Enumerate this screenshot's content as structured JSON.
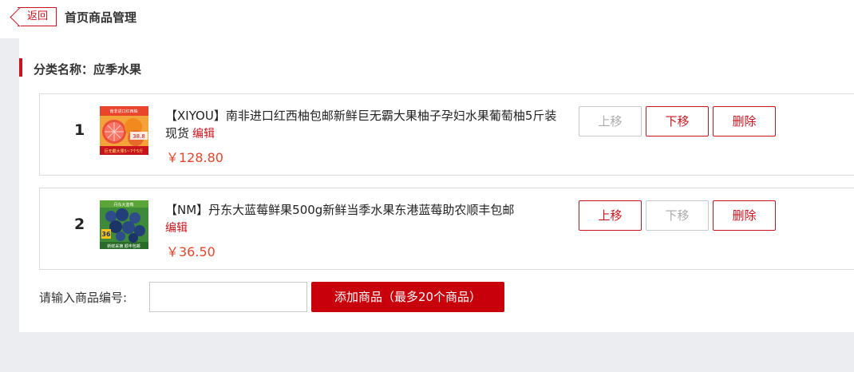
{
  "header": {
    "back_label": "返回",
    "title": "首页商品管理"
  },
  "category": {
    "label": "分类名称：应季水果"
  },
  "products": [
    {
      "index": "1",
      "name": "【XIYOU】南非进口红西柚包邮新鲜巨无霸大果柚子孕妇水果葡萄柚5斤装现货",
      "edit_label": "编辑",
      "price": "￥128.80",
      "thumb_text_top": "南非进口红西柚",
      "thumb_text_bottom": "巨无霸大果5~7个5斤",
      "thumb_badge": "38.8",
      "up_label": "上移",
      "up_disabled": true,
      "down_label": "下移",
      "down_disabled": false,
      "delete_label": "删除"
    },
    {
      "index": "2",
      "name": "【NM】丹东大蓝莓鲜果500g新鲜当季水果东港蓝莓助农顺丰包邮",
      "edit_label": "编辑",
      "price": "￥36.50",
      "thumb_text_top": "丹东大蓝莓",
      "thumb_text_bottom": "新鲜采摘 顺丰包邮",
      "thumb_badge": "36",
      "up_label": "上移",
      "up_disabled": false,
      "down_label": "下移",
      "down_disabled": true,
      "delete_label": "删除"
    }
  ],
  "add_section": {
    "label": "请输入商品编号:",
    "input_value": "",
    "input_placeholder": "",
    "add_button_label": "添加商品（最多20个商品）"
  },
  "colors": {
    "accent": "#c8151d",
    "price": "#e5452b",
    "background": "#ecedf1"
  }
}
